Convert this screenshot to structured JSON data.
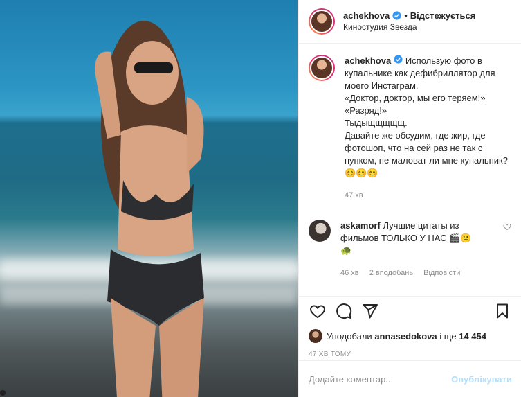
{
  "post": {
    "username": "achekhova",
    "follow_status": "Відстежується",
    "separator": "•",
    "location": "Киностудия Звезда"
  },
  "caption": {
    "username": "achekhova",
    "text": "Использую фото в купальнике как дефибриллятор для моего Инстаграм.\n«Доктор, доктор, мы его теряем!»\n«Разряд!»\nТыдыщщщщщ.\nДавайте же обсудим, где жир, где фотошоп, что на сей раз не так с пупком, не маловат ли мне купальник?",
    "emojis": "😊😊😊",
    "time": "47 хв"
  },
  "reply": {
    "username": "askamorf",
    "text": "Лучшие цитаты из фильмов ТОЛЬКО У НАС",
    "emojis": "🎬😕",
    "emoji_line2": "🐢",
    "time": "46 хв",
    "likes": "2 вподобань",
    "reply_label": "Відповісти"
  },
  "likes": {
    "prefix": "Уподобали",
    "user": "annasedokova",
    "middle": "і ще",
    "count": "14 454"
  },
  "time_ago": "47 ХВ ТОМУ",
  "comment_box": {
    "placeholder": "Додайте коментар...",
    "publish_label": "Опублікувати"
  },
  "icons": {
    "verified": "verified-badge-icon",
    "like": "heart-icon",
    "comment": "speech-bubble-icon",
    "share": "paper-plane-icon",
    "save": "bookmark-icon"
  },
  "colors": {
    "verified_blue": "#3897f0",
    "muted": "#8e8e8e",
    "publish_disabled": "#b2dffc"
  }
}
